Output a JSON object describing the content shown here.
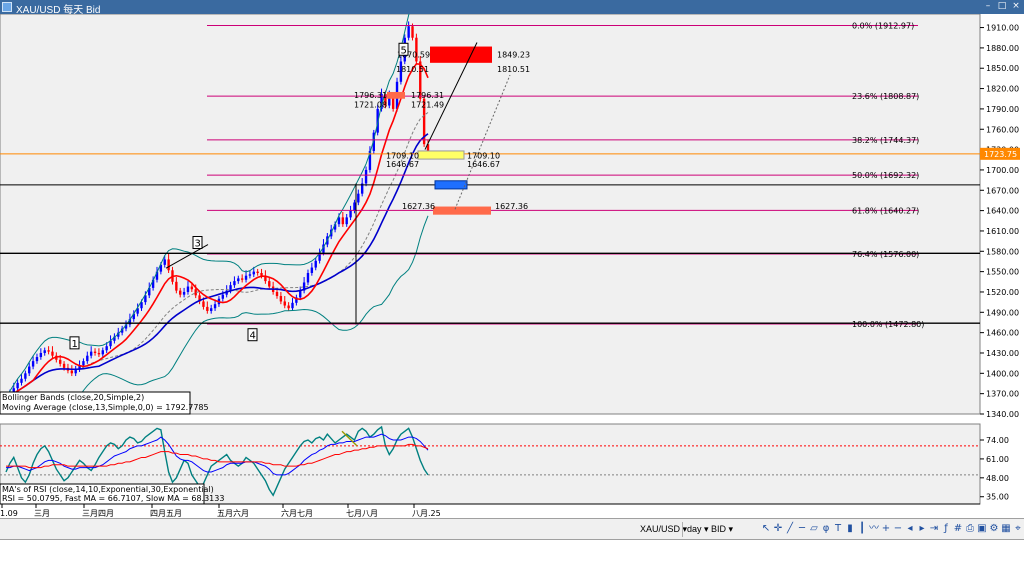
{
  "window": {
    "title": "XAU/USD 每天 Bid",
    "btn_min": "–",
    "btn_max": "□",
    "btn_close": "×"
  },
  "toolbar": {
    "symbol": "XAU/USD ▾",
    "period": "day ▾",
    "side": "BID ▾",
    "icons": [
      "arrow-icon",
      "crosshair-icon",
      "line-icon",
      "horizontal-line-icon",
      "channel-icon",
      "fibonacci-icon",
      "text-icon",
      "candles-icon",
      "bars-icon",
      "line-chart-icon",
      "zoom-in-icon",
      "zoom-out-icon",
      "scroll-left-icon",
      "scroll-right-icon",
      "autoscroll-icon",
      "indicators-icon",
      "grid-icon",
      "print-icon",
      "save-icon",
      "settings-icon",
      "layout-icon",
      "crosshair-mode-icon"
    ]
  },
  "colors": {
    "bg": "#f0f0f0",
    "bull": "#0000ff",
    "bear": "#ff0000",
    "bb": "#008080",
    "ma13": "#0000cc",
    "red_ma": "#ff0000",
    "fib": "#cc0077",
    "rsi": "#008080",
    "fast_ma": "#0000ff",
    "slow_ma": "#ff0000"
  },
  "chart_data": [
    {
      "type": "candlestick",
      "ylim": [
        1340,
        1930
      ],
      "y_ticks": [
        "1910.00",
        "1880.00",
        "1850.00",
        "1820.00",
        "1790.00",
        "1760.00",
        "1730.00",
        "1700.00",
        "1670.00",
        "1640.00",
        "1610.00",
        "1580.00",
        "1550.00",
        "1520.00",
        "1490.00",
        "1460.00",
        "1430.00",
        "1400.00",
        "1370.00",
        "1340.00"
      ],
      "x_ticks": [
        "1.09",
        "三月",
        "三月四月",
        "四月五月",
        "五月六月",
        "六月七月",
        "七月八月",
        "八月.25"
      ],
      "current_price": "1723.75",
      "fib_levels": [
        {
          "label": "0.0%  (1912.97)",
          "value": 1912.97
        },
        {
          "label": "23.6%  (1808.87)",
          "value": 1808.87
        },
        {
          "label": "38.2%  (1744.37)",
          "value": 1744.37
        },
        {
          "label": "50.0%  (1692.32)",
          "value": 1692.32
        },
        {
          "label": "61.8%  (1640.27)",
          "value": 1640.27
        },
        {
          "label": "76.4%  (1576.00)",
          "value": 1576.0
        },
        {
          "label": "100.0%  (1472.80)",
          "value": 1472.8
        }
      ],
      "price_labels": [
        "1870.59",
        "1849.23",
        "1810.51",
        "1810.51",
        "1796.31",
        "1796.31",
        "1721.08",
        "1721.49",
        "1709.10",
        "1709.10",
        "1646.67",
        "1646.67",
        "1627.36",
        "1627.36"
      ],
      "wave_labels": [
        "1",
        "3",
        "4",
        "5"
      ],
      "legend": [
        "Bollinger Bands (close,20,Simple,2)",
        "Moving Average (close,13,Simple,0,0) = 1792.7785"
      ],
      "closes": [
        1362,
        1370,
        1378,
        1386,
        1392,
        1400,
        1410,
        1418,
        1424,
        1430,
        1434,
        1432,
        1426,
        1420,
        1414,
        1408,
        1404,
        1400,
        1406,
        1412,
        1418,
        1426,
        1432,
        1430,
        1428,
        1434,
        1440,
        1448,
        1454,
        1460,
        1466,
        1472,
        1480,
        1488,
        1496,
        1505,
        1515,
        1526,
        1538,
        1550,
        1560,
        1568,
        1552,
        1535,
        1522,
        1516,
        1520,
        1528,
        1524,
        1515,
        1506,
        1498,
        1492,
        1496,
        1502,
        1510,
        1516,
        1522,
        1530,
        1536,
        1540,
        1538,
        1544,
        1546,
        1550,
        1548,
        1544,
        1536,
        1528,
        1520,
        1514,
        1506,
        1500,
        1496,
        1504,
        1512,
        1522,
        1534,
        1548,
        1556,
        1566,
        1578,
        1590,
        1602,
        1612,
        1620,
        1630,
        1620,
        1630,
        1640,
        1652,
        1665,
        1680,
        1700,
        1728,
        1755,
        1790,
        1812,
        1795,
        1810,
        1790,
        1830,
        1860,
        1895,
        1912,
        1895,
        1860,
        1805,
        1738,
        1722
      ]
    },
    {
      "type": "line",
      "title": "MA's of RSI (close,14,10,Exponential,30,Exponential)",
      "values_label": "RSI = 50.0795, Fast MA = 66.7107, Slow MA = 68.3133",
      "ylim": [
        30,
        85
      ],
      "y_ticks": [
        "74.00",
        "61.00",
        "48.00",
        "35.00"
      ],
      "levels": [
        70,
        50
      ],
      "series": [
        {
          "name": "RSI",
          "values": [
            52,
            58,
            62,
            55,
            48,
            45,
            50,
            58,
            64,
            68,
            70,
            66,
            60,
            54,
            50,
            46,
            48,
            52,
            56,
            60,
            58,
            55,
            53,
            57,
            62,
            66,
            70,
            72,
            71,
            68,
            70,
            74,
            76,
            75,
            72,
            73,
            76,
            78,
            80,
            82,
            81,
            66,
            52,
            45,
            48,
            54,
            60,
            58,
            50,
            46,
            42,
            44,
            50,
            56,
            58,
            60,
            62,
            64,
            60,
            58,
            56,
            58,
            62,
            60,
            58,
            54,
            50,
            46,
            40,
            36,
            42,
            48,
            54,
            58,
            62,
            66,
            70,
            73,
            74,
            72,
            75,
            76,
            74,
            78,
            75,
            72,
            74,
            76,
            78,
            76,
            74,
            80,
            82,
            80,
            76,
            78,
            81,
            83,
            70,
            64,
            68,
            74,
            78,
            80,
            82,
            76,
            68,
            60,
            54,
            50
          ]
        },
        {
          "name": "Fast MA",
          "values": [
            55,
            55,
            56,
            56,
            55,
            54,
            53,
            54,
            55,
            57,
            59,
            60,
            60,
            59,
            58,
            56,
            55,
            54,
            54,
            55,
            55,
            55,
            55,
            55,
            56,
            57,
            59,
            61,
            63,
            64,
            65,
            66,
            68,
            69,
            70,
            70,
            71,
            72,
            73,
            74,
            76,
            74,
            71,
            67,
            63,
            61,
            60,
            60,
            59,
            57,
            55,
            53,
            52,
            52,
            53,
            54,
            55,
            57,
            58,
            58,
            58,
            58,
            59,
            59,
            59,
            58,
            57,
            56,
            54,
            51,
            50,
            50,
            50,
            51,
            53,
            55,
            57,
            60,
            62,
            64,
            65,
            67,
            68,
            70,
            71,
            71,
            72,
            72,
            73,
            73,
            73,
            74,
            75,
            76,
            76,
            76,
            77,
            78,
            77,
            75,
            74,
            74,
            74,
            75,
            76,
            76,
            75,
            73,
            70,
            67
          ]
        },
        {
          "name": "Slow MA",
          "values": [
            56,
            56,
            56,
            56,
            56,
            56,
            55,
            55,
            55,
            55,
            56,
            56,
            57,
            57,
            57,
            57,
            56,
            56,
            56,
            56,
            56,
            56,
            56,
            56,
            56,
            56,
            56,
            57,
            57,
            58,
            58,
            59,
            59,
            60,
            61,
            62,
            62,
            63,
            64,
            65,
            66,
            66,
            66,
            65,
            65,
            64,
            64,
            64,
            63,
            63,
            62,
            61,
            61,
            60,
            60,
            59,
            59,
            59,
            59,
            59,
            59,
            59,
            59,
            59,
            59,
            59,
            59,
            58,
            58,
            57,
            57,
            57,
            56,
            56,
            56,
            56,
            57,
            57,
            58,
            58,
            59,
            60,
            61,
            62,
            63,
            64,
            64,
            65,
            66,
            66,
            67,
            67,
            68,
            68,
            69,
            69,
            70,
            70,
            70,
            70,
            70,
            70,
            70,
            70,
            71,
            71,
            70,
            70,
            69,
            68
          ]
        }
      ]
    }
  ]
}
